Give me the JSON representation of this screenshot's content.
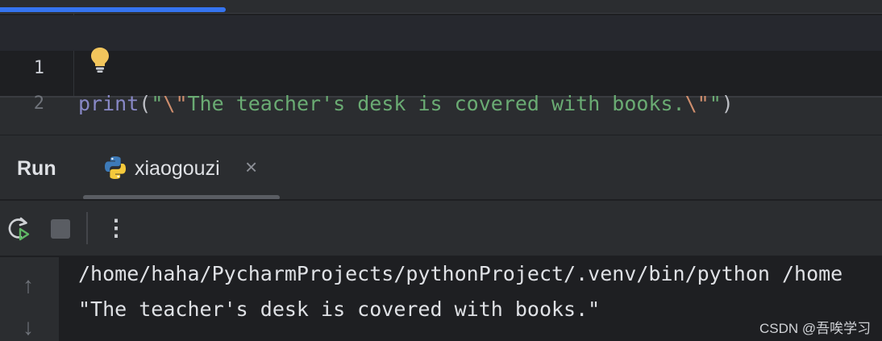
{
  "editor": {
    "lines": [
      {
        "number": "1",
        "tokens": {
          "fn": "print",
          "open": "(",
          "q1": "\"",
          "esc1": "\\\"",
          "text": "The teacher's desk is covered with books.",
          "esc2": "\\\"",
          "q2": "\"",
          "close": ")"
        }
      },
      {
        "number": "2"
      }
    ],
    "intention_icon": "lightbulb-icon"
  },
  "run_panel": {
    "title": "Run",
    "tab": {
      "label": "xiaogouzi",
      "icon": "python-icon",
      "close_glyph": "×"
    },
    "toolbar": {
      "rerun_icon": "rerun-icon",
      "stop_icon": "stop-icon",
      "more_glyph": "⋮"
    },
    "gutter": {
      "up_glyph": "↑",
      "down_glyph": "↓"
    },
    "output": [
      "/home/haha/PycharmProjects/pythonProject/.venv/bin/python /home",
      "\"The teacher's desk is covered with books.\""
    ]
  },
  "watermark": "CSDN @吾唉学习",
  "colors": {
    "accent": "#3574f0",
    "keyword_fn": "#8888c6",
    "string": "#6aab73",
    "escape": "#cf8e6d",
    "editor_bg": "#1e1f22",
    "panel_bg": "#2b2d30"
  }
}
